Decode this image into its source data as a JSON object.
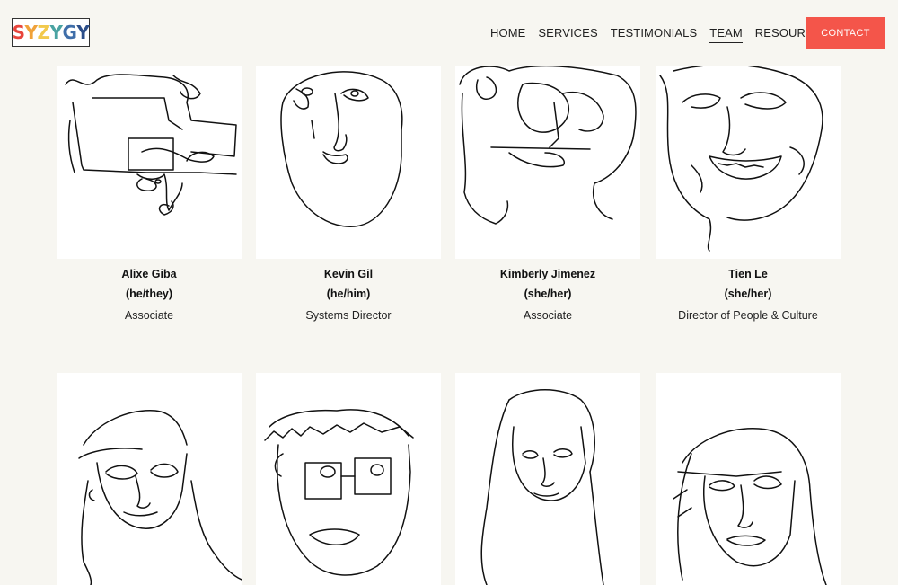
{
  "header": {
    "logo_letters": [
      "S",
      "Y",
      "Z",
      "Y",
      "G",
      "Y"
    ],
    "logo_colors": [
      "#e8453c",
      "#f0a23a",
      "#f2c94c",
      "#4aa3a2",
      "#3f6ea9",
      "#2d4f8a"
    ],
    "nav": [
      "HOME",
      "SERVICES",
      "TESTIMONIALS",
      "TEAM",
      "RESOURCES"
    ],
    "active_nav": "TEAM",
    "contact_label": "CONTACT"
  },
  "colors": {
    "background": "#f7f6f1",
    "accent": "#f4554a",
    "card": "#ffffff"
  },
  "team": [
    {
      "name": "Alixe Giba",
      "pronouns": "(he/they)",
      "role": "Associate"
    },
    {
      "name": "Kevin Gil",
      "pronouns": "(he/him)",
      "role": "Systems Director"
    },
    {
      "name": "Kimberly Jimenez",
      "pronouns": "(she/her)",
      "role": "Associate"
    },
    {
      "name": "Tien Le",
      "pronouns": "(she/her)",
      "role": "Director of People & Culture"
    }
  ]
}
